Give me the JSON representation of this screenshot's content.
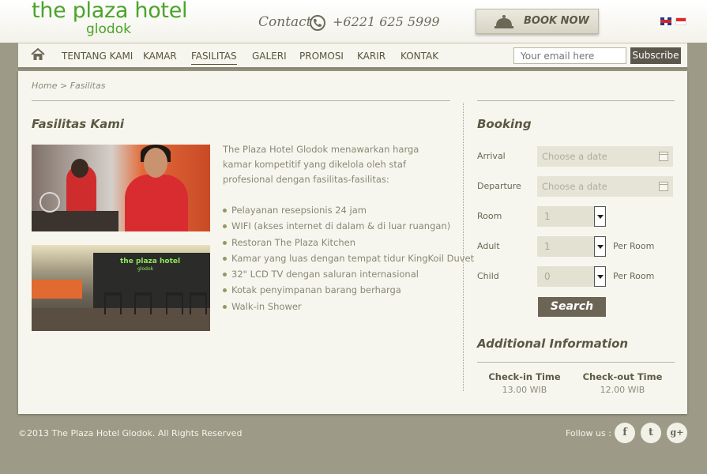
{
  "header": {
    "logo_main": "the plaza hotel",
    "logo_sub": "glodok",
    "contact_label": "Contact",
    "phone": "+6221 625 5999",
    "book_label": "BOOK NOW",
    "flags": [
      "flag-en-icon",
      "flag-id-icon"
    ]
  },
  "nav": {
    "items": [
      "TENTANG KAMI",
      "KAMAR",
      "FASILITAS",
      "GALERI",
      "PROMOSI",
      "KARIR",
      "KONTAK"
    ],
    "active": "FASILITAS",
    "email_placeholder": "Your email here",
    "subscribe_label": "Subscribe"
  },
  "breadcrumb": "Home > Fasilitas",
  "facilities": {
    "title": "Fasilitas Kami",
    "intro": "The Plaza Hotel Glodok menawarkan harga kamar kompetitif yang dikelola oleh staf profesional dengan fasilitas-fasilitas:",
    "photo_sign": "the plaza hotel",
    "photo_sign_sub": "glodok",
    "items": [
      "Pelayanan resepsionis 24 jam",
      "WIFI (akses internet di dalam & di luar ruangan)",
      "Restoran The Plaza Kitchen",
      "Kamar yang luas dengan tempat tidur KingKoil Duvet",
      "32\" LCD TV dengan saluran internasional",
      "Kotak penyimpanan barang berharga",
      "Walk-in Shower"
    ]
  },
  "booking": {
    "title": "Booking",
    "arrival_label": "Arrival",
    "departure_label": "Departure",
    "room_label": "Room",
    "adult_label": "Adult",
    "child_label": "Child",
    "date_placeholder": "Choose a date",
    "room_value": "1",
    "adult_value": "1",
    "child_value": "0",
    "per_room": "Per Room",
    "search_label": "Search"
  },
  "info": {
    "title": "Additional Information",
    "checkin_label": "Check-in Time",
    "checkin_value": "13.00 WIB",
    "checkout_label": "Check-out Time",
    "checkout_value": "12.00 WIB"
  },
  "footer": {
    "copyright": "©2013 The Plaza Hotel Glodok. All Rights Reserved",
    "follow": "Follow us :",
    "social": [
      "f",
      "t",
      "g+"
    ]
  },
  "colors": {
    "brand_green": "#4ba42a",
    "background": "#9d9b87",
    "panel": "#f7f6ee",
    "button_dark": "#6c6555"
  }
}
